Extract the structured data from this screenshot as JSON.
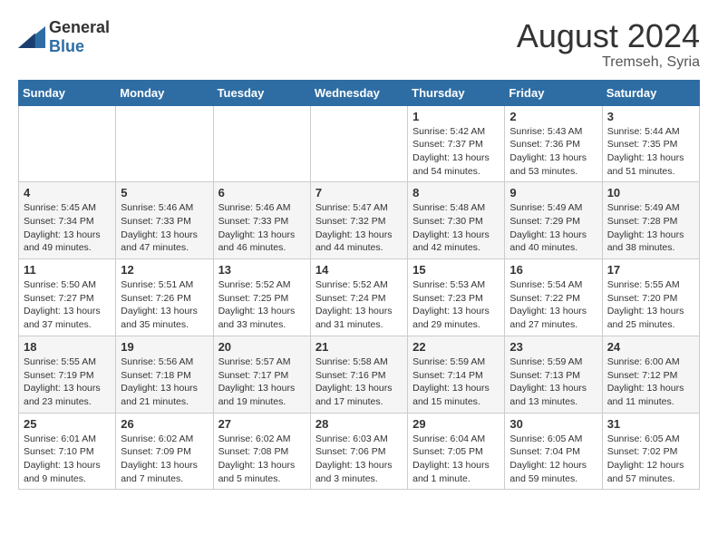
{
  "logo": {
    "general": "General",
    "blue": "Blue"
  },
  "title": "August 2024",
  "subtitle": "Tremseh, Syria",
  "days_header": [
    "Sunday",
    "Monday",
    "Tuesday",
    "Wednesday",
    "Thursday",
    "Friday",
    "Saturday"
  ],
  "weeks": [
    [
      {
        "day": "",
        "sunrise": "",
        "sunset": "",
        "daylight": ""
      },
      {
        "day": "",
        "sunrise": "",
        "sunset": "",
        "daylight": ""
      },
      {
        "day": "",
        "sunrise": "",
        "sunset": "",
        "daylight": ""
      },
      {
        "day": "",
        "sunrise": "",
        "sunset": "",
        "daylight": ""
      },
      {
        "day": "1",
        "sunrise": "Sunrise: 5:42 AM",
        "sunset": "Sunset: 7:37 PM",
        "daylight": "Daylight: 13 hours and 54 minutes."
      },
      {
        "day": "2",
        "sunrise": "Sunrise: 5:43 AM",
        "sunset": "Sunset: 7:36 PM",
        "daylight": "Daylight: 13 hours and 53 minutes."
      },
      {
        "day": "3",
        "sunrise": "Sunrise: 5:44 AM",
        "sunset": "Sunset: 7:35 PM",
        "daylight": "Daylight: 13 hours and 51 minutes."
      }
    ],
    [
      {
        "day": "4",
        "sunrise": "Sunrise: 5:45 AM",
        "sunset": "Sunset: 7:34 PM",
        "daylight": "Daylight: 13 hours and 49 minutes."
      },
      {
        "day": "5",
        "sunrise": "Sunrise: 5:46 AM",
        "sunset": "Sunset: 7:33 PM",
        "daylight": "Daylight: 13 hours and 47 minutes."
      },
      {
        "day": "6",
        "sunrise": "Sunrise: 5:46 AM",
        "sunset": "Sunset: 7:33 PM",
        "daylight": "Daylight: 13 hours and 46 minutes."
      },
      {
        "day": "7",
        "sunrise": "Sunrise: 5:47 AM",
        "sunset": "Sunset: 7:32 PM",
        "daylight": "Daylight: 13 hours and 44 minutes."
      },
      {
        "day": "8",
        "sunrise": "Sunrise: 5:48 AM",
        "sunset": "Sunset: 7:30 PM",
        "daylight": "Daylight: 13 hours and 42 minutes."
      },
      {
        "day": "9",
        "sunrise": "Sunrise: 5:49 AM",
        "sunset": "Sunset: 7:29 PM",
        "daylight": "Daylight: 13 hours and 40 minutes."
      },
      {
        "day": "10",
        "sunrise": "Sunrise: 5:49 AM",
        "sunset": "Sunset: 7:28 PM",
        "daylight": "Daylight: 13 hours and 38 minutes."
      }
    ],
    [
      {
        "day": "11",
        "sunrise": "Sunrise: 5:50 AM",
        "sunset": "Sunset: 7:27 PM",
        "daylight": "Daylight: 13 hours and 37 minutes."
      },
      {
        "day": "12",
        "sunrise": "Sunrise: 5:51 AM",
        "sunset": "Sunset: 7:26 PM",
        "daylight": "Daylight: 13 hours and 35 minutes."
      },
      {
        "day": "13",
        "sunrise": "Sunrise: 5:52 AM",
        "sunset": "Sunset: 7:25 PM",
        "daylight": "Daylight: 13 hours and 33 minutes."
      },
      {
        "day": "14",
        "sunrise": "Sunrise: 5:52 AM",
        "sunset": "Sunset: 7:24 PM",
        "daylight": "Daylight: 13 hours and 31 minutes."
      },
      {
        "day": "15",
        "sunrise": "Sunrise: 5:53 AM",
        "sunset": "Sunset: 7:23 PM",
        "daylight": "Daylight: 13 hours and 29 minutes."
      },
      {
        "day": "16",
        "sunrise": "Sunrise: 5:54 AM",
        "sunset": "Sunset: 7:22 PM",
        "daylight": "Daylight: 13 hours and 27 minutes."
      },
      {
        "day": "17",
        "sunrise": "Sunrise: 5:55 AM",
        "sunset": "Sunset: 7:20 PM",
        "daylight": "Daylight: 13 hours and 25 minutes."
      }
    ],
    [
      {
        "day": "18",
        "sunrise": "Sunrise: 5:55 AM",
        "sunset": "Sunset: 7:19 PM",
        "daylight": "Daylight: 13 hours and 23 minutes."
      },
      {
        "day": "19",
        "sunrise": "Sunrise: 5:56 AM",
        "sunset": "Sunset: 7:18 PM",
        "daylight": "Daylight: 13 hours and 21 minutes."
      },
      {
        "day": "20",
        "sunrise": "Sunrise: 5:57 AM",
        "sunset": "Sunset: 7:17 PM",
        "daylight": "Daylight: 13 hours and 19 minutes."
      },
      {
        "day": "21",
        "sunrise": "Sunrise: 5:58 AM",
        "sunset": "Sunset: 7:16 PM",
        "daylight": "Daylight: 13 hours and 17 minutes."
      },
      {
        "day": "22",
        "sunrise": "Sunrise: 5:59 AM",
        "sunset": "Sunset: 7:14 PM",
        "daylight": "Daylight: 13 hours and 15 minutes."
      },
      {
        "day": "23",
        "sunrise": "Sunrise: 5:59 AM",
        "sunset": "Sunset: 7:13 PM",
        "daylight": "Daylight: 13 hours and 13 minutes."
      },
      {
        "day": "24",
        "sunrise": "Sunrise: 6:00 AM",
        "sunset": "Sunset: 7:12 PM",
        "daylight": "Daylight: 13 hours and 11 minutes."
      }
    ],
    [
      {
        "day": "25",
        "sunrise": "Sunrise: 6:01 AM",
        "sunset": "Sunset: 7:10 PM",
        "daylight": "Daylight: 13 hours and 9 minutes."
      },
      {
        "day": "26",
        "sunrise": "Sunrise: 6:02 AM",
        "sunset": "Sunset: 7:09 PM",
        "daylight": "Daylight: 13 hours and 7 minutes."
      },
      {
        "day": "27",
        "sunrise": "Sunrise: 6:02 AM",
        "sunset": "Sunset: 7:08 PM",
        "daylight": "Daylight: 13 hours and 5 minutes."
      },
      {
        "day": "28",
        "sunrise": "Sunrise: 6:03 AM",
        "sunset": "Sunset: 7:06 PM",
        "daylight": "Daylight: 13 hours and 3 minutes."
      },
      {
        "day": "29",
        "sunrise": "Sunrise: 6:04 AM",
        "sunset": "Sunset: 7:05 PM",
        "daylight": "Daylight: 13 hours and 1 minute."
      },
      {
        "day": "30",
        "sunrise": "Sunrise: 6:05 AM",
        "sunset": "Sunset: 7:04 PM",
        "daylight": "Daylight: 12 hours and 59 minutes."
      },
      {
        "day": "31",
        "sunrise": "Sunrise: 6:05 AM",
        "sunset": "Sunset: 7:02 PM",
        "daylight": "Daylight: 12 hours and 57 minutes."
      }
    ]
  ]
}
